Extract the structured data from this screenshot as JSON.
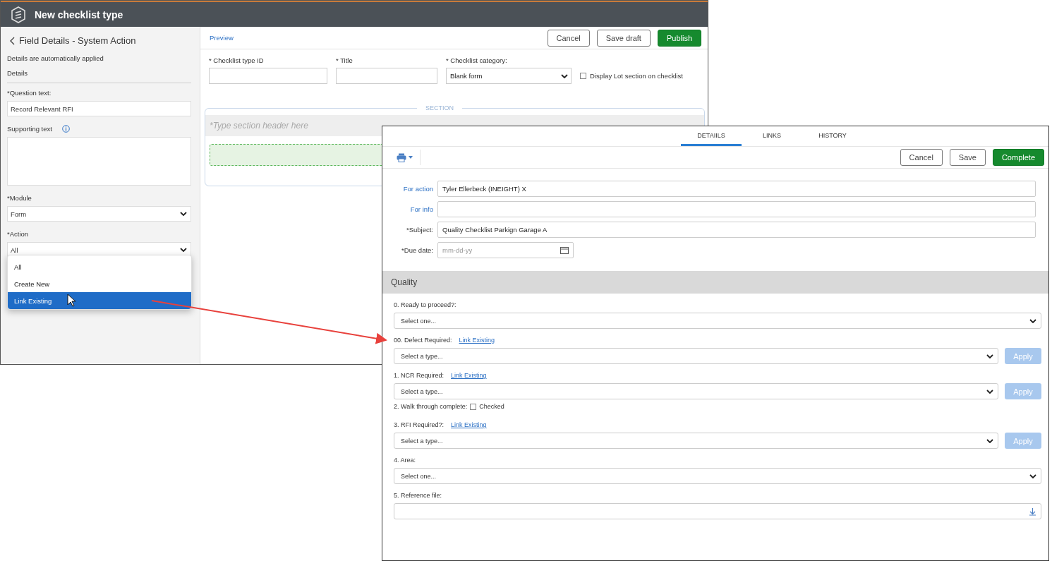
{
  "back_window": {
    "title": "New checklist type",
    "panel": {
      "back_title": "Field Details - System Action",
      "note": "Details are automatically applied",
      "section": "Details",
      "question_label": "*Question text:",
      "question_value": "Record Relevant RFI",
      "supporting_label": "Supporting text",
      "module_label": "*Module",
      "module_value": "Form",
      "action_label": "*Action",
      "action_value": "All",
      "action_options": [
        {
          "label": "All",
          "selected": false
        },
        {
          "label": "Create New",
          "selected": false
        },
        {
          "label": "Link Existing",
          "selected": true
        }
      ]
    },
    "preview_link": "Preview",
    "buttons": [
      {
        "label": "Cancel",
        "kind": "outline"
      },
      {
        "label": "Save draft",
        "kind": "outline"
      },
      {
        "label": "Publish",
        "kind": "primary"
      }
    ],
    "fields": [
      {
        "label": "* Checklist type ID",
        "kind": "text"
      },
      {
        "label": "* Title",
        "kind": "text"
      },
      {
        "label": "* Checklist category:",
        "kind": "select",
        "value": "Blank form"
      }
    ],
    "lot_checkbox": {
      "label": "Display Lot section on checklist",
      "checked": false
    },
    "section_label": "SECTION",
    "section_header_placeholder": "*Type section header here"
  },
  "front_window": {
    "tabs": [
      {
        "label": "DETAIILS",
        "selected": true
      },
      {
        "label": "LINKS",
        "selected": false
      },
      {
        "label": "HISTORY",
        "selected": false
      }
    ],
    "buttons": [
      {
        "label": "Cancel",
        "kind": "outline"
      },
      {
        "label": "Save",
        "kind": "outline"
      },
      {
        "label": "Complete",
        "kind": "primary"
      }
    ],
    "header_fields": [
      {
        "label": "For action",
        "kind": "link",
        "value": "Tyler Ellerbeck (INEIGHT) X"
      },
      {
        "label": "For info",
        "kind": "link"
      },
      {
        "label": "*Subject:",
        "kind": "plain",
        "value": "Quality Checklist Parkign Garage A"
      },
      {
        "label": "*Due date:",
        "kind": "date",
        "placeholder": "mm-dd-yy"
      }
    ],
    "section_title": "Quality",
    "questions": [
      {
        "label": "0. Ready to proceed?:",
        "kind": "select",
        "placeholder": "Select one..."
      },
      {
        "label": "00. Defect Required:",
        "kind": "link_select",
        "link": "Link Existing",
        "placeholder": "Select a type...",
        "apply": "Apply",
        "disabled": true
      },
      {
        "label": "1. NCR Required:",
        "kind": "link_select",
        "link": "Link Existing",
        "placeholder": "Select a type...",
        "apply": "Apply",
        "disabled": true
      },
      {
        "label": "2. Walk through complete:",
        "kind": "checkbox",
        "option": "Checked",
        "checked": false
      },
      {
        "label": "3. RFI Required?:",
        "kind": "link_select",
        "link": "Link Existing",
        "placeholder": "Select a type...",
        "apply": "Apply",
        "disabled": true
      },
      {
        "label": "4. Area:",
        "kind": "select",
        "placeholder": "Select one..."
      },
      {
        "label": "5. Reference file:",
        "kind": "file"
      }
    ]
  }
}
